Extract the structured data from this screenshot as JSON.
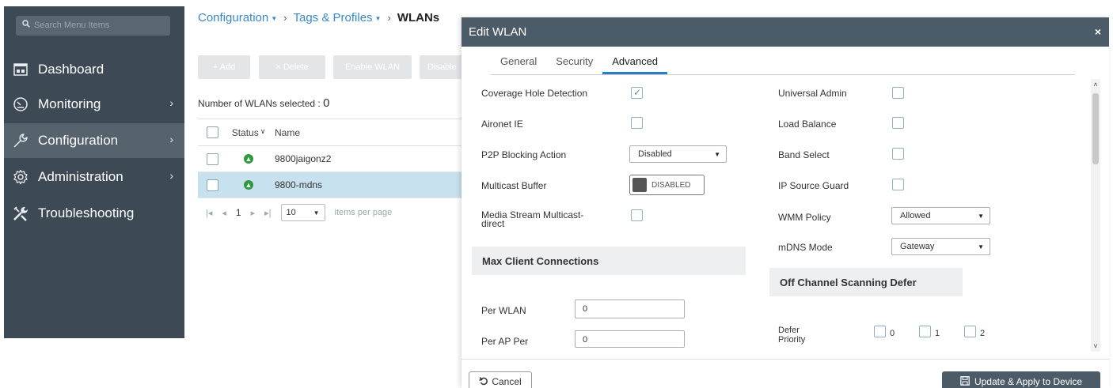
{
  "sidebar": {
    "search_placeholder": "Search Menu Items",
    "items": [
      {
        "label": "Dashboard",
        "icon": "dashboard-icon"
      },
      {
        "label": "Monitoring",
        "icon": "gauge-icon"
      },
      {
        "label": "Configuration",
        "icon": "wrench-icon",
        "active": true
      },
      {
        "label": "Administration",
        "icon": "gear-icon"
      },
      {
        "label": "Troubleshooting",
        "icon": "tools-icon"
      }
    ]
  },
  "breadcrumb": {
    "items": [
      "Configuration",
      "Tags & Profiles",
      "WLANs"
    ]
  },
  "toolbar": {
    "add_label": "+ Add",
    "delete_label": "× Delete",
    "enable_label": "Enable WLAN",
    "disable_label": "Disable"
  },
  "wlan_list": {
    "selected_label": "Number of WLANs selected :",
    "selected_count": "0",
    "columns": [
      "Status",
      "Name"
    ],
    "rows": [
      {
        "status": "up",
        "name": "9800jaigonz2"
      },
      {
        "status": "up",
        "name": "9800-mdns"
      }
    ],
    "pager": {
      "page": "1",
      "page_size": "10",
      "items_per_page_label": "items per page"
    }
  },
  "modal": {
    "title": "Edit WLAN",
    "close": "×",
    "tabs": [
      "General",
      "Security",
      "Advanced"
    ],
    "active_tab": "Advanced",
    "left": {
      "coverage_hole_detection": {
        "label": "Coverage Hole Detection",
        "checked": true
      },
      "aironet_ie": {
        "label": "Aironet IE",
        "checked": false
      },
      "p2p_blocking": {
        "label": "P2P Blocking Action",
        "value": "Disabled"
      },
      "multicast_buffer": {
        "label": "Multicast Buffer",
        "value": "DISABLED"
      },
      "media_stream_line1": "Media Stream Multicast-",
      "media_stream_line2": "direct",
      "max_client_title": "Max Client Connections",
      "per_wlan": {
        "label": "Per WLAN",
        "value": "0"
      },
      "per_ap_per": {
        "label": "Per AP Per",
        "value": "0"
      }
    },
    "right": {
      "universal_admin": {
        "label": "Universal Admin",
        "checked": false
      },
      "load_balance": {
        "label": "Load Balance",
        "checked": false
      },
      "band_select": {
        "label": "Band Select",
        "checked": false
      },
      "ip_source_guard": {
        "label": "IP Source Guard",
        "checked": false
      },
      "wmm_policy": {
        "label": "WMM Policy",
        "value": "Allowed"
      },
      "mdns_mode": {
        "label": "mDNS Mode",
        "value": "Gateway"
      },
      "off_channel_title": "Off Channel Scanning Defer",
      "defer_priority_line1": "Defer",
      "defer_priority_line2": "Priority",
      "defer_options": [
        "0",
        "1",
        "2"
      ]
    },
    "cancel_label": "Cancel",
    "apply_label": "Update & Apply to Device"
  }
}
